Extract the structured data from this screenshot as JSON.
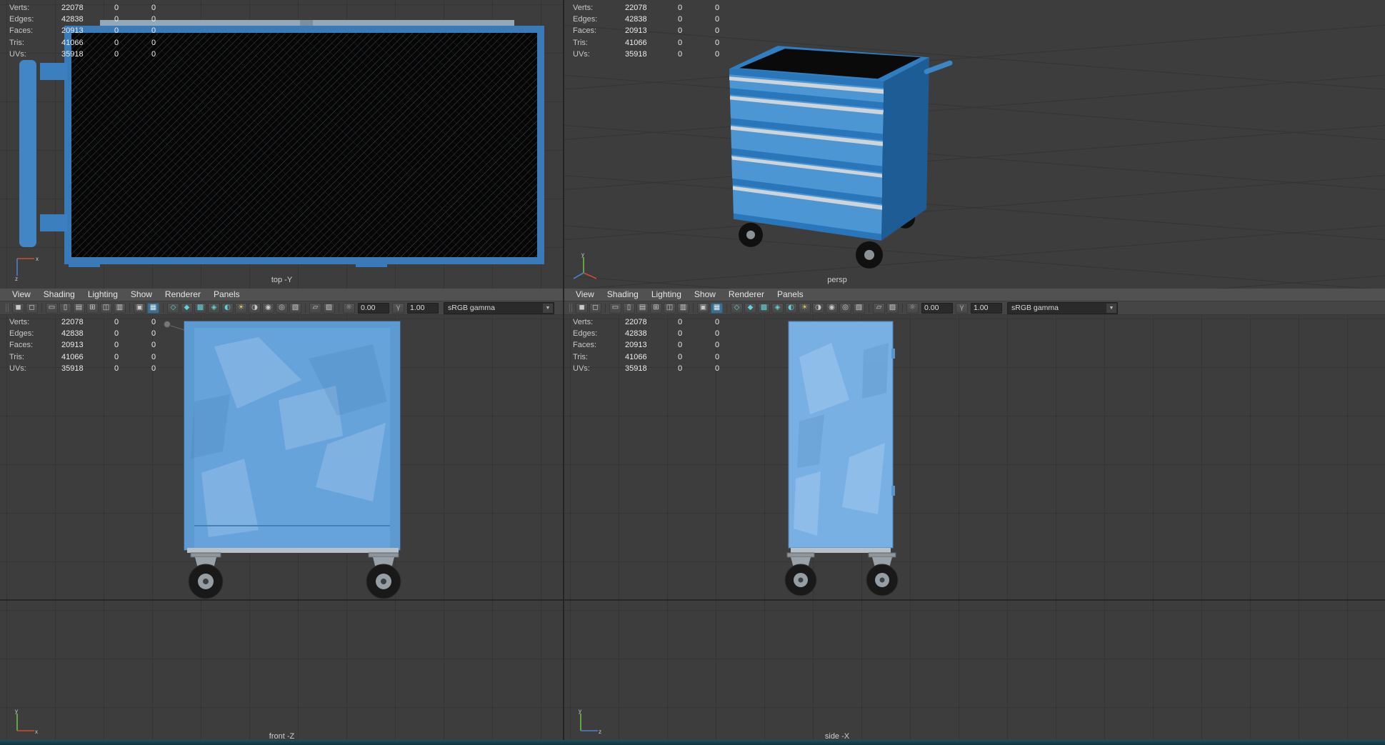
{
  "colors": {
    "cart_blue": "#3b82c4",
    "selection_teal": "#5ed3da",
    "hud_text": "#ececec"
  },
  "hud": {
    "rows": [
      {
        "label": "Verts:",
        "v1": "22078",
        "v2": "0",
        "v3": "0"
      },
      {
        "label": "Edges:",
        "v1": "42838",
        "v2": "0",
        "v3": "0"
      },
      {
        "label": "Faces:",
        "v1": "20913",
        "v2": "0",
        "v3": "0"
      },
      {
        "label": "Tris:",
        "v1": "41066",
        "v2": "0",
        "v3": "0"
      },
      {
        "label": "UVs:",
        "v1": "35918",
        "v2": "0",
        "v3": "0"
      }
    ]
  },
  "menu": {
    "items": [
      "View",
      "Shading",
      "Lighting",
      "Show",
      "Renderer",
      "Panels"
    ]
  },
  "toolbar": {
    "items": [
      {
        "t": "grip",
        "name": "toolbar-grip"
      },
      {
        "t": "icon",
        "name": "select-camera-icon",
        "glyph": "◼"
      },
      {
        "t": "icon",
        "name": "lock-camera-icon",
        "glyph": "◻"
      },
      {
        "t": "sep"
      },
      {
        "t": "icon",
        "name": "film-gate-icon",
        "glyph": "▭"
      },
      {
        "t": "icon",
        "name": "resolution-gate-icon",
        "glyph": "▯"
      },
      {
        "t": "icon",
        "name": "gate-mask-icon",
        "glyph": "▤"
      },
      {
        "t": "icon",
        "name": "field-chart-icon",
        "glyph": "⊞"
      },
      {
        "t": "icon",
        "name": "safe-action-icon",
        "glyph": "◫"
      },
      {
        "t": "icon",
        "name": "safe-title-icon",
        "glyph": "▥"
      },
      {
        "t": "sep"
      },
      {
        "t": "icon",
        "name": "heads-up-display-icon",
        "glyph": "▣"
      },
      {
        "t": "icon",
        "name": "grid-toggle-icon",
        "glyph": "▦",
        "state": "active"
      },
      {
        "t": "sep"
      },
      {
        "t": "icon",
        "name": "wireframe-mode-icon",
        "glyph": "◇",
        "tone": "teal"
      },
      {
        "t": "icon",
        "name": "shaded-mode-icon",
        "glyph": "◆",
        "tone": "teal"
      },
      {
        "t": "icon",
        "name": "textured-mode-icon",
        "glyph": "▩",
        "tone": "teal"
      },
      {
        "t": "icon",
        "name": "wireframe-on-shaded-icon",
        "glyph": "◈",
        "tone": "teal"
      },
      {
        "t": "icon",
        "name": "material-override-icon",
        "glyph": "◐",
        "tone": "teal"
      },
      {
        "t": "icon",
        "name": "lighting-all-icon",
        "glyph": "☀",
        "tone": "yellow"
      },
      {
        "t": "icon",
        "name": "shadows-icon",
        "glyph": "◑"
      },
      {
        "t": "icon",
        "name": "ambient-occlusion-icon",
        "glyph": "◉"
      },
      {
        "t": "icon",
        "name": "motion-blur-icon",
        "glyph": "◎"
      },
      {
        "t": "icon",
        "name": "anti-alias-icon",
        "glyph": "▧"
      },
      {
        "t": "sep"
      },
      {
        "t": "icon",
        "name": "isolate-select-icon",
        "glyph": "▱"
      },
      {
        "t": "icon",
        "name": "xray-icon",
        "glyph": "▨"
      },
      {
        "t": "sep"
      },
      {
        "t": "icon",
        "name": "exposure-icon",
        "glyph": "☼",
        "tone": "dim"
      },
      {
        "t": "field",
        "name": "exposure-field",
        "value": "0.00"
      },
      {
        "t": "icon",
        "name": "gamma-icon",
        "glyph": "γ",
        "tone": "dim"
      },
      {
        "t": "field",
        "name": "gamma-field",
        "value": "1.00"
      },
      {
        "t": "dropdown",
        "name": "colorspace-dropdown",
        "value": "sRGB gamma",
        "arrow": "▼"
      }
    ]
  },
  "views": {
    "top_label": "top -Y",
    "persp_label": "persp",
    "front_label": "front -Z",
    "side_label": "side -X"
  }
}
